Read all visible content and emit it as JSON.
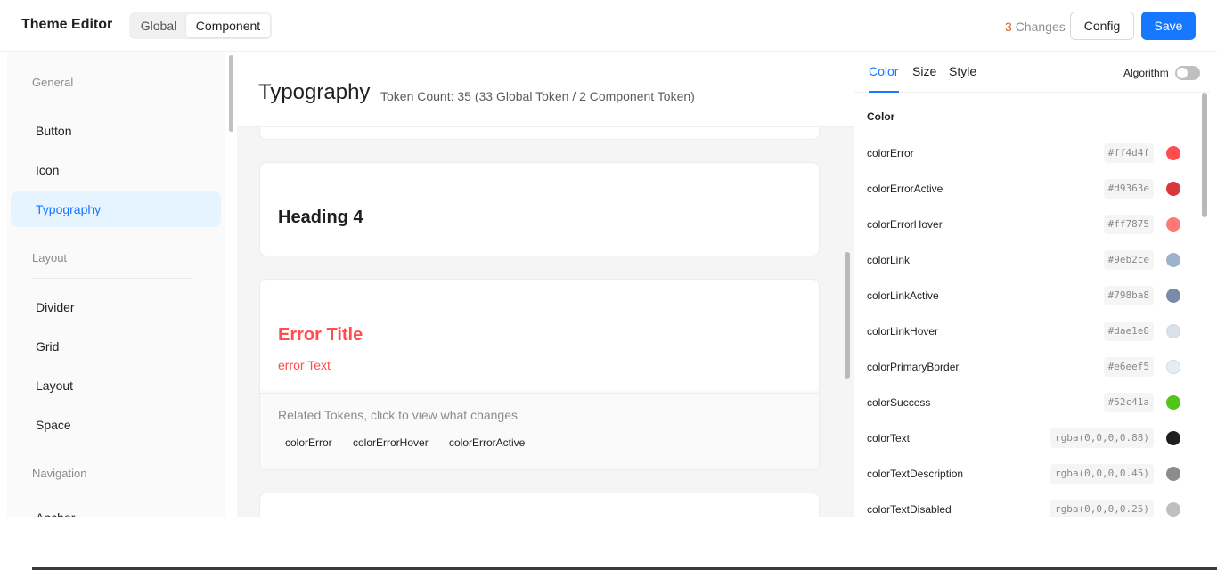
{
  "header": {
    "title": "Theme Editor",
    "segmented": {
      "global": "Global",
      "component": "Component"
    },
    "changes_count": "3",
    "changes_label": "Changes",
    "config_label": "Config",
    "save_label": "Save"
  },
  "sidebar": {
    "groups": [
      {
        "title": "General",
        "items": [
          "Button",
          "Icon",
          "Typography"
        ]
      },
      {
        "title": "Layout",
        "items": [
          "Divider",
          "Grid",
          "Layout",
          "Space"
        ]
      },
      {
        "title": "Navigation",
        "items": [
          "Anchor"
        ]
      }
    ],
    "active_item": "Typography"
  },
  "main": {
    "title": "Typography",
    "token_count": "Token Count: 35 (33 Global Token / 2 Component Token)",
    "heading4_demo": "Heading 4",
    "error_title_demo": "Error Title",
    "error_text_demo": "error Text",
    "related_label": "Related Tokens, click to view what changes",
    "related_tokens": [
      "colorError",
      "colorErrorHover",
      "colorErrorActive"
    ]
  },
  "panel": {
    "tabs": [
      "Color",
      "Size",
      "Style"
    ],
    "active_tab": "Color",
    "algorithm_label": "Algorithm",
    "algorithm_on": false,
    "section_title": "Color",
    "tokens": [
      {
        "name": "colorError",
        "value": "#ff4d4f",
        "color": "#ff4d4f"
      },
      {
        "name": "colorErrorActive",
        "value": "#d9363e",
        "color": "#d9363e"
      },
      {
        "name": "colorErrorHover",
        "value": "#ff7875",
        "color": "#ff7875"
      },
      {
        "name": "colorLink",
        "value": "#9eb2ce",
        "color": "#9eb2ce"
      },
      {
        "name": "colorLinkActive",
        "value": "#798ba8",
        "color": "#798ba8"
      },
      {
        "name": "colorLinkHover",
        "value": "#dae1e8",
        "color": "#dae1e8"
      },
      {
        "name": "colorPrimaryBorder",
        "value": "#e6eef5",
        "color": "#e6eef5"
      },
      {
        "name": "colorSuccess",
        "value": "#52c41a",
        "color": "#52c41a"
      },
      {
        "name": "colorText",
        "value": "rgba(0,0,0,0.88)",
        "color": "rgba(0,0,0,0.88)"
      },
      {
        "name": "colorTextDescription",
        "value": "rgba(0,0,0,0.45)",
        "color": "rgba(0,0,0,0.45)"
      },
      {
        "name": "colorTextDisabled",
        "value": "rgba(0,0,0,0.25)",
        "color": "rgba(0,0,0,0.25)"
      }
    ]
  },
  "colors": {
    "accent": "#1677ff",
    "error": "#ff4d4f",
    "changes_count": "#d4622c",
    "active_nav_bg": "#e6f4ff"
  }
}
